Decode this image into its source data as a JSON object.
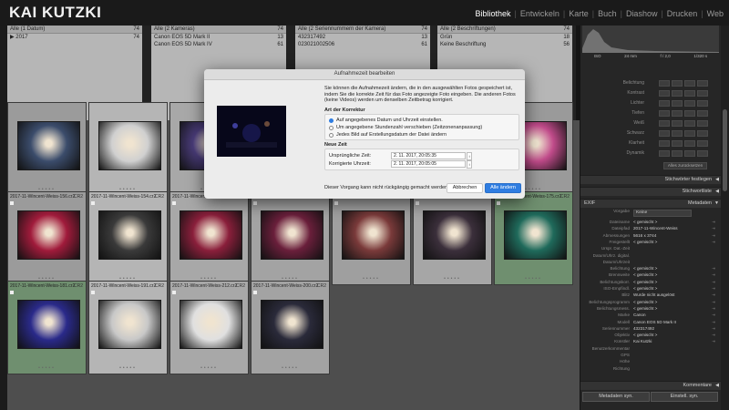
{
  "brand": "KAI KUTZKI",
  "modules": [
    {
      "label": "Bibliothek",
      "active": true
    },
    {
      "label": "Entwickeln",
      "active": false
    },
    {
      "label": "Karte",
      "active": false
    },
    {
      "label": "Buch",
      "active": false
    },
    {
      "label": "Diashow",
      "active": false
    },
    {
      "label": "Drucken",
      "active": false
    },
    {
      "label": "Web",
      "active": false
    }
  ],
  "filter_columns": [
    {
      "header": "Alle (1 Datum)",
      "count": "74",
      "rows": [
        {
          "label": "▶ 2017",
          "count": "74",
          "selected": false
        }
      ]
    },
    {
      "header": "Alle (2 Kameras)",
      "count": "74",
      "rows": [
        {
          "label": "Canon EOS 5D Mark II",
          "count": "13",
          "selected": false
        },
        {
          "label": "Canon EOS 5D Mark IV",
          "count": "61",
          "selected": false
        }
      ]
    },
    {
      "header": "Alle (2 Seriennummern der Kamera)",
      "count": "74",
      "rows": [
        {
          "label": "432317492",
          "count": "13",
          "selected": false
        },
        {
          "label": "023021002506",
          "count": "61",
          "selected": false
        }
      ]
    },
    {
      "header": "Alle (2 Beschriftungen)",
      "count": "74",
      "rows": [
        {
          "label": "Grün",
          "count": "18",
          "selected": false
        },
        {
          "label": "Keine Beschriftung",
          "count": "56",
          "selected": false
        }
      ]
    }
  ],
  "grid": {
    "cells": [
      {
        "name": "",
        "ext": "",
        "thumb_bg": "#3b4c6b"
      },
      {
        "name": "",
        "ext": "",
        "thumb_bg": "#d0d0d0"
      },
      {
        "name": "",
        "ext": "",
        "thumb_bg": "#4a3c7a"
      },
      {
        "name": "",
        "ext": "",
        "thumb_bg": "#3a2f5a"
      },
      {
        "name": "",
        "ext": "",
        "thumb_bg": "#2a2a3a"
      },
      {
        "name": "",
        "ext": "",
        "thumb_bg": "#3a2a3a"
      },
      {
        "name": "",
        "ext": "",
        "thumb_bg": "#c04b8a"
      },
      {
        "name": "2017-11-Wincent-Weiss-156.cr2",
        "ext": "CR2",
        "thumb_bg": "#a01b3b"
      },
      {
        "name": "2017-11-Wincent-Weiss-154.cr2",
        "ext": "CR2",
        "thumb_bg": "#3a3a3a"
      },
      {
        "name": "2017-11-Wincent-Weiss-1...",
        "ext": "CR2",
        "thumb_bg": "#8a1f3b"
      },
      {
        "name": "2017-11-Wincent-Weiss-...",
        "ext": "CR2",
        "thumb_bg": "#6a1f3b"
      },
      {
        "name": "2017-11-Wincent-Weiss-...",
        "ext": "CR2",
        "thumb_bg": "#7a3a3a"
      },
      {
        "name": "2017-11-Wincent-Weiss-...",
        "ext": "CR2",
        "thumb_bg": "#3b2f3b"
      },
      {
        "name": "2017-11-Wincent-Weiss-175.cr2",
        "ext": "CR2",
        "thumb_bg": "#1f6a5b"
      },
      {
        "name": "2017-11-Wincent-Weiss-181.cr2",
        "ext": "CR2",
        "thumb_bg": "#2a2a8a"
      },
      {
        "name": "2017-11-Wincent-Weiss-191.cr2",
        "ext": "CR2",
        "thumb_bg": "#c8c8c8"
      },
      {
        "name": "2017-11-Wincent-Weiss-212.cr2",
        "ext": "CR2",
        "thumb_bg": "#e0e0e0"
      },
      {
        "name": "2017-11-Wincent-Weiss-200.cr2",
        "ext": "CR2",
        "thumb_bg": "#2a2a3a"
      }
    ]
  },
  "dialog": {
    "title": "Aufnahmezeit bearbeiten",
    "description": "Sie können die Aufnahmezeit ändern, die in den ausgewählten Fotos gespeichert ist, indem Sie die korrekte Zeit für das Foto angezeigte Foto eingeben. Die anderen Fotos (keine Videos) werden um denselben Zeitbetrag korrigiert.",
    "type_section": "Art der Korrektur",
    "options": [
      {
        "label": "Auf angegebenes Datum und Uhrzeit einstellen.",
        "selected": true
      },
      {
        "label": "Um angegebene Stundenzahl verschieben (Zeitzonenanpassung)",
        "selected": false
      },
      {
        "label": "Jedes Bild auf Erstellungsdatum der Datei ändern",
        "selected": false
      }
    ],
    "new_time_section": "Neue Zeit",
    "original_label": "Ursprüngliche Zeit:",
    "original_value": "2. 11. 2017, 20:05:35",
    "corrected_label": "Korrigierte Uhrzeit:",
    "corrected_value": "2. 11. 2017, 20:05:05",
    "warning": "Dieser Vorgang kann nicht rückgängig gemacht werden.",
    "cancel_label": "Abbrechen",
    "ok_label": "Alle ändern"
  },
  "right_panel": {
    "histogram_info": [
      "ISO",
      "24 mm",
      "f / 2,0",
      "1/320 s"
    ],
    "develop_rows": [
      "Belichtung",
      "Kontrast",
      "Lichter",
      "Tiefen",
      "Weiß",
      "Schwarz",
      "Klarheit",
      "Dynamik"
    ],
    "reset_label": "Alles zurücksetzen",
    "stichwort_label": "Stichwörter festlegen",
    "stichwortliste_label": "Stichwortliste",
    "metadata_label": "Metadaten",
    "preset_label": "EXIF",
    "vorgabe_label": "Vorgabe",
    "vorgabe_value": "Keine",
    "metadata_rows": [
      {
        "k": "Dateiname",
        "v": "< gemischt >"
      },
      {
        "k": "Dateipfad",
        "v": "2017-11-Wincent-Weiss"
      },
      {
        "k": "Abmessungen",
        "v": "5616 x 3744"
      },
      {
        "k": "Freigestellt",
        "v": "< gemischt >"
      },
      {
        "k": "Urspr. Dat.-Zeit",
        "v": ""
      },
      {
        "k": "Datum/Uhrz. digital.",
        "v": ""
      },
      {
        "k": "Datum/Uhrzeit",
        "v": ""
      },
      {
        "k": "Belichtung",
        "v": "< gemischt >"
      },
      {
        "k": "Brennweite",
        "v": "< gemischt >"
      },
      {
        "k": "Belichtungskorr.",
        "v": "< gemischt >"
      },
      {
        "k": "ISO-Empfindl.",
        "v": "< gemischt >"
      },
      {
        "k": "Blitz",
        "v": "Wurde nicht ausgelöst"
      },
      {
        "k": "Belichtungsprogramm",
        "v": "< gemischt >"
      },
      {
        "k": "Belichtungsmess.",
        "v": "< gemischt >"
      },
      {
        "k": "Marke",
        "v": "Canon"
      },
      {
        "k": "Modell",
        "v": "Canon EOS 5D Mark II"
      },
      {
        "k": "Seriennummer",
        "v": "432317492"
      },
      {
        "k": "Objektiv",
        "v": "< gemischt >"
      },
      {
        "k": "Künstler",
        "v": "Kai Kutzki"
      },
      {
        "k": "Benutzerkommentar",
        "v": ""
      },
      {
        "k": "GPS",
        "v": ""
      },
      {
        "k": "Höhe",
        "v": ""
      },
      {
        "k": "Richtung",
        "v": ""
      }
    ],
    "comments_label": "Kommentare",
    "sync_meta_label": "Metadaten syn.",
    "sync_settings_label": "Einstell. syn."
  }
}
